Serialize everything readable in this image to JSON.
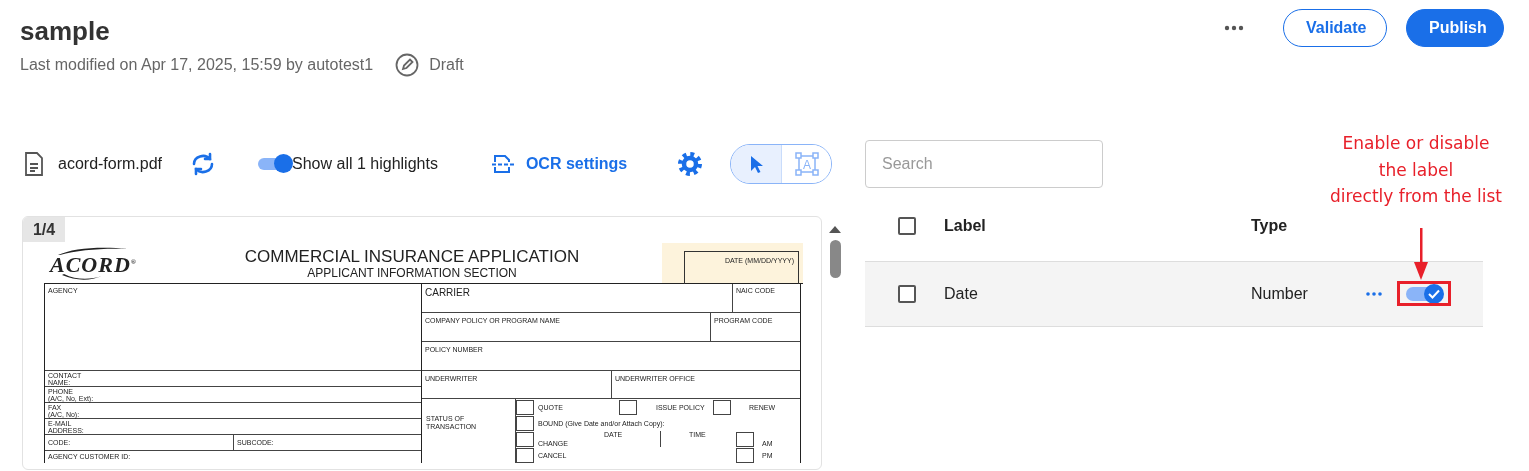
{
  "header": {
    "title": "sample",
    "last_modified": "Last modified on Apr 17, 2025, 15:59 by autotest1",
    "status": "Draft",
    "buttons": [
      {
        "label": "Validate",
        "kind": "outline"
      },
      {
        "label": "Publish",
        "kind": "primary"
      }
    ]
  },
  "toolbar": {
    "file_name": "acord-form.pdf",
    "highlights_toggle": {
      "label": "Show all 1 highlights",
      "on": true
    },
    "ocr_link": "OCR settings",
    "modes": [
      {
        "kind": "pointer",
        "selected": true
      },
      {
        "kind": "text-box",
        "glyph": "A",
        "selected": false
      }
    ]
  },
  "document": {
    "page": "1/4",
    "form": {
      "logo": "ACORD$^{®}$",
      "title": "COMMERCIAL INSURANCE APPLICATION",
      "subtitle": "APPLICANT INFORMATION SECTION",
      "date_field": {
        "label": "DATE (MM/DD/YYYY)",
        "highlighted": true
      },
      "agency": "AGENCY",
      "contact": "CONTACT\nNAME:",
      "phone": "PHONE\n(A/C, No, Ext):",
      "fax": "FAX\n(A/C, No):",
      "email": "E-MAIL\nADDRESS:",
      "code": "CODE:",
      "subcode": "SUBCODE:",
      "customer_id": "AGENCY CUSTOMER ID:",
      "carrier": "CARRIER",
      "naic": "NAIC CODE",
      "program_name": "COMPANY POLICY OR PROGRAM NAME",
      "program_code": "PROGRAM CODE",
      "policy_number": "POLICY NUMBER",
      "underwriter": "UNDERWRITER",
      "underwriter_office": "UNDERWRITER OFFICE",
      "checkboxes": [
        {
          "checked": false
        },
        {
          "checked": false
        },
        {
          "checked": false
        },
        {
          "checked": false
        },
        {
          "checked": false
        },
        {
          "checked": false
        },
        {
          "checked": false
        },
        {
          "checked": false
        }
      ],
      "status": "STATUS OF\nTRANSACTION",
      "quote": "QUOTE",
      "issue": "ISSUE POLICY",
      "renew": "RENEW",
      "bound": "BOUND (Give Date and/or Attach Copy):",
      "change": "CHANGE",
      "date": "DATE",
      "time": "TIME",
      "am": "AM",
      "cancel": "CANCEL",
      "pm": "PM"
    }
  },
  "labels_panel": {
    "search": {
      "placeholder": "Search"
    },
    "select_all_checked": false,
    "columns": [
      "Label",
      "Type"
    ],
    "rows": [
      {
        "label": "Date",
        "type": "Number",
        "checked": false,
        "enabled": true
      }
    ]
  },
  "annotation": {
    "text": "Enable or disable\nthe label\ndirectly from the list"
  }
}
